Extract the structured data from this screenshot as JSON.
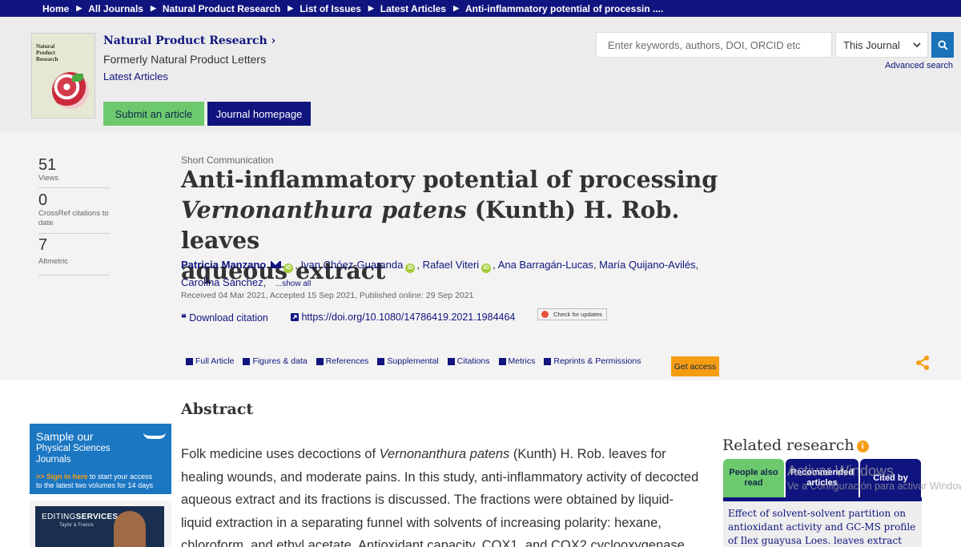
{
  "breadcrumb": {
    "items": [
      "Home",
      "All Journals",
      "Natural Product Research",
      "List of Issues",
      "Latest Articles",
      "Anti-inflammatory potential of processin ...."
    ]
  },
  "journal": {
    "title": "Natural Product Research",
    "title_chevron": "›",
    "formerly": "Formerly Natural Product Letters",
    "latest": "Latest Articles",
    "cover_text": "Natural Product Research",
    "submit_label": "Submit an article",
    "homepage_label": "Journal homepage"
  },
  "search": {
    "placeholder": "Enter keywords, authors, DOI, ORCID etc",
    "scope_selected": "This Journal",
    "advanced": "Advanced search"
  },
  "metrics": [
    {
      "value": "51",
      "label": "Views"
    },
    {
      "value": "0",
      "label": "CrossRef citations to date"
    },
    {
      "value": "7",
      "label": "Altmetric"
    }
  ],
  "article": {
    "type": "Short Communication",
    "title_line1": "Anti-inflammatory potential of processing",
    "title_italic": "Vernonanthura patens",
    "title_rest": " (Kunth) H. Rob. leaves",
    "title_line3": "aqueous extract",
    "authors": {
      "first": "Patricia Manzano",
      "a2": "Ivan Chóez-Guaranda",
      "a3": "Rafael Viteri",
      "a4": "Ana Barragán-Lucas",
      "a5": "María Quijano-Avilés",
      "a6": "Carolina Sánchez",
      "show_all": "...show all",
      "orcid_glyph": "iD"
    },
    "dates": "Received 04 Mar 2021, Accepted 15 Sep 2021, Published online: 29 Sep 2021",
    "download_citation": "Download citation",
    "doi": "https://doi.org/10.1080/14786419.2021.1984464",
    "check_updates": "Check for updates"
  },
  "tabs": [
    "Full Article",
    "Figures & data",
    "References",
    "Supplemental",
    "Citations",
    "Metrics",
    "Reprints & Permissions"
  ],
  "get_access": "Get access",
  "abstract": {
    "heading": "Abstract",
    "p1_pre": "Folk medicine uses decoctions of ",
    "p1_italic": "Vernonanthura patens",
    "p1_post": " (Kunth) H. Rob. leaves for healing wounds, and moderate pains. In this study, anti-inflammatory activity of decocted aqueous extract and its fractions is discussed. The fractions were obtained by liquid-liquid extraction in a separating funnel with solvents of increasing polarity: hexane, chloroform, and ethyl acetate. Antioxidant capacity, COX1, and COX2 cyclooxygenase"
  },
  "ads": {
    "sample_title": "Sample our",
    "sample_sub1": "Physical Sciences",
    "sample_sub2": "Journals",
    "sample_arrow": ">>",
    "sample_cta_bold": "Sign in here",
    "sample_cta": " to start your access",
    "sample_cta2": "to the latest two volumes for 14 days",
    "editing_bold": "EDITING",
    "editing": "SERVICES",
    "editing_sub": "Taylor & Francis"
  },
  "related": {
    "heading": "Related research",
    "info_glyph": "i",
    "tabs": [
      "People also read",
      "Recommended articles",
      "Cited by"
    ],
    "first_item": "Effect of solvent-solvent partition on antioxidant activity and GC-MS profile of Ilex guayusa Loes. leaves extract and"
  },
  "watermark": {
    "line1": "Activar Windows",
    "line2": "Ve a Configuración para activar Windows."
  },
  "colors": {
    "navy": "#10147e",
    "green": "#6dc96d",
    "orange": "#f59c13",
    "blue": "#1a72b8",
    "orcid_green": "#a5cd39"
  }
}
